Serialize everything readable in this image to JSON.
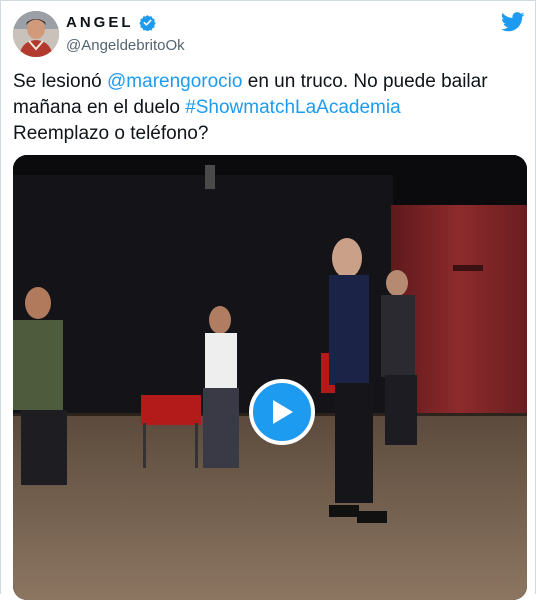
{
  "tweet": {
    "display_name": "ANGEL",
    "handle": "@AngeldebritoOk",
    "text_part1": "Se lesionó ",
    "mention": "@marengorocio",
    "text_part2": " en un truco. No puede bailar mañana en el duelo ",
    "hashtag": "#ShowmatchLaAcademia",
    "text_part3": "Reemplazo o teléfono?"
  },
  "icons": {
    "verified": "verified-badge-icon",
    "brand": "twitter-bird-icon",
    "play": "play-icon"
  },
  "colors": {
    "link": "#1d9bf0",
    "verified": "#1d9bf0",
    "brand": "#1d9bf0"
  }
}
